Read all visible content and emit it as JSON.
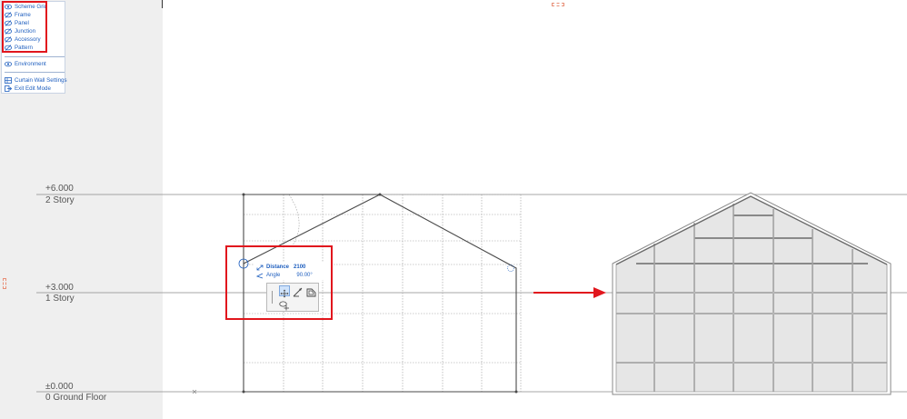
{
  "edit_panel": {
    "items": [
      {
        "label": "Scheme Grid",
        "icon": "eye-icon"
      },
      {
        "label": "Frame",
        "icon": "eye-hidden-icon"
      },
      {
        "label": "Panel",
        "icon": "eye-hidden-icon"
      },
      {
        "label": "Junction",
        "icon": "eye-hidden-icon"
      },
      {
        "label": "Accessory",
        "icon": "eye-hidden-icon"
      },
      {
        "label": "Pattern",
        "icon": "eye-hidden-icon"
      }
    ],
    "environment": "Environment",
    "settings": "Curtain Wall Settings",
    "exit": "Exit Edit Mode"
  },
  "stories": [
    {
      "elevation": "+6.000",
      "name": "2 Story"
    },
    {
      "elevation": "+3.000",
      "name": "1 Story"
    },
    {
      "elevation": "±0.000",
      "name": "0 Ground Floor"
    }
  ],
  "tracker": {
    "distance_label": "Distance",
    "distance_value": "2100",
    "angle_label": "Angle",
    "angle_value": "90.00°"
  },
  "pet_palette": {
    "buttons": [
      "move-icon",
      "rotate-icon",
      "offset-icon",
      "drag-copy-icon"
    ]
  },
  "colors": {
    "accent_blue": "#1f5fbf",
    "highlight_red": "#e1161d",
    "gutter_gray": "#efefef",
    "panel_fill": "#e6e6e6"
  }
}
